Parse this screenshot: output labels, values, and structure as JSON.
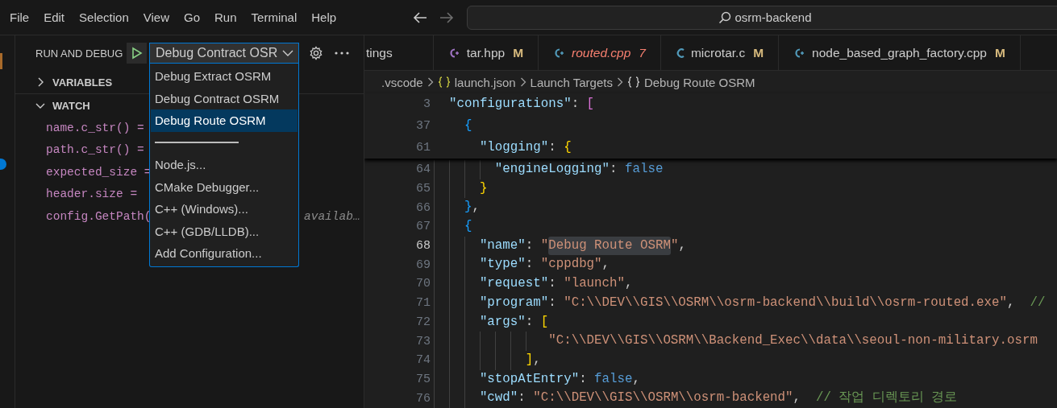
{
  "menu": [
    "File",
    "Edit",
    "Selection",
    "View",
    "Go",
    "Run",
    "Terminal",
    "Help"
  ],
  "search": {
    "value": "osrm-backend"
  },
  "sidebar": {
    "title": "RUN AND DEBUG",
    "config_select": {
      "value": "Debug Contract OSR",
      "expanded": true
    },
    "config_menu": [
      {
        "kind": "option",
        "label": "Debug Extract OSRM",
        "selected": false
      },
      {
        "kind": "option",
        "label": "Debug Contract OSRM",
        "selected": false
      },
      {
        "kind": "option",
        "label": "Debug Route OSRM",
        "selected": true
      },
      {
        "kind": "separator"
      },
      {
        "kind": "option",
        "label": "Node.js...",
        "selected": false
      },
      {
        "kind": "option",
        "label": "CMake Debugger...",
        "selected": false
      },
      {
        "kind": "option",
        "label": "C++ (Windows)...",
        "selected": false
      },
      {
        "kind": "option",
        "label": "C++ (GDB/LLDB)...",
        "selected": false
      },
      {
        "kind": "option",
        "label": "Add Configuration...",
        "selected": false
      }
    ],
    "sections": [
      {
        "title": "VARIABLES",
        "expanded": false
      },
      {
        "title": "WATCH",
        "expanded": true,
        "items": [
          {
            "expression": "name.c_str() ="
          },
          {
            "expression": "path.c_str() ="
          },
          {
            "expression": "expected_size ="
          },
          {
            "expression": "header.size ="
          },
          {
            "expression": "config.GetPath(",
            "value": "availab…"
          }
        ]
      }
    ]
  },
  "tabs": [
    {
      "label": "tings",
      "kind": "none",
      "error": false,
      "preview": false,
      "selected": false
    },
    {
      "label": "tar.hpp",
      "kind": "cpp-header",
      "status": "M",
      "error": false,
      "preview": false,
      "selected": false
    },
    {
      "label": "routed.cpp",
      "kind": "cpp",
      "status": "7",
      "error": true,
      "preview": true,
      "selected": false
    },
    {
      "label": "microtar.c",
      "kind": "c",
      "status": "M",
      "error": false,
      "preview": false,
      "selected": false
    },
    {
      "label": "node_based_graph_factory.cpp",
      "kind": "cpp",
      "status": "M",
      "error": false,
      "preview": false,
      "selected": false
    }
  ],
  "breadcrumbs": [
    {
      "label": ".vscode",
      "kind": "folder"
    },
    {
      "label": "launch.json",
      "kind": "json"
    },
    {
      "label": "Launch Targets",
      "kind": "folder"
    },
    {
      "label": "Debug Route OSRM",
      "kind": "object"
    }
  ],
  "sticky_lines": [
    {
      "number": "3",
      "current": false,
      "tokens": [
        {
          "text": "  \"configurations\"",
          "kind": "key"
        },
        {
          "text": ": ",
          "kind": "punct"
        },
        {
          "text": "[",
          "kind": "b2"
        }
      ]
    },
    {
      "number": "37",
      "current": false,
      "tokens": [
        {
          "text": "    {",
          "kind": "b3"
        }
      ]
    },
    {
      "number": "61",
      "current": false,
      "tokens": [
        {
          "text": "      \"logging\"",
          "kind": "key"
        },
        {
          "text": ": ",
          "kind": "punct"
        },
        {
          "text": "{",
          "kind": "b1"
        }
      ]
    }
  ],
  "lines": [
    {
      "number": "64",
      "current": false,
      "tokens": [
        {
          "text": "        \"engineLogging\"",
          "kind": "key"
        },
        {
          "text": ": ",
          "kind": "punct"
        },
        {
          "text": "false",
          "kind": "kw"
        }
      ]
    },
    {
      "number": "65",
      "current": false,
      "tokens": [
        {
          "text": "      }",
          "kind": "b1"
        }
      ]
    },
    {
      "number": "66",
      "current": false,
      "tokens": [
        {
          "text": "    }",
          "kind": "b3"
        },
        {
          "text": ",",
          "kind": "punct"
        }
      ]
    },
    {
      "number": "67",
      "current": false,
      "tokens": [
        {
          "text": "    {",
          "kind": "b3"
        }
      ]
    },
    {
      "number": "68",
      "current": true,
      "tokens": [
        {
          "text": "      \"name\"",
          "kind": "key"
        },
        {
          "text": ": ",
          "kind": "punct"
        },
        {
          "text": "\"",
          "kind": "str"
        },
        {
          "text": "Debug Route OSRM",
          "kind": "match"
        },
        {
          "text": "\"",
          "kind": "str"
        },
        {
          "text": ",",
          "kind": "punct"
        }
      ]
    },
    {
      "number": "69",
      "current": false,
      "tokens": [
        {
          "text": "      \"type\"",
          "kind": "key"
        },
        {
          "text": ": ",
          "kind": "punct"
        },
        {
          "text": "\"cppdbg\"",
          "kind": "str"
        },
        {
          "text": ",",
          "kind": "punct"
        }
      ]
    },
    {
      "number": "70",
      "current": false,
      "tokens": [
        {
          "text": "      \"request\"",
          "kind": "key"
        },
        {
          "text": ": ",
          "kind": "punct"
        },
        {
          "text": "\"launch\"",
          "kind": "str"
        },
        {
          "text": ",",
          "kind": "punct"
        }
      ]
    },
    {
      "number": "71",
      "current": false,
      "tokens": [
        {
          "text": "      \"program\"",
          "kind": "key"
        },
        {
          "text": ": ",
          "kind": "punct"
        },
        {
          "text": "\"C:\\\\DEV\\\\GIS\\\\OSRM\\\\osrm-backend\\\\build\\\\osrm-routed.exe\"",
          "kind": "str"
        },
        {
          "text": ",  ",
          "kind": "punct"
        },
        {
          "text": "//",
          "kind": "comment"
        }
      ]
    },
    {
      "number": "72",
      "current": false,
      "tokens": [
        {
          "text": "      \"args\"",
          "kind": "key"
        },
        {
          "text": ": ",
          "kind": "punct"
        },
        {
          "text": "[",
          "kind": "b1"
        }
      ]
    },
    {
      "number": "73",
      "current": false,
      "tokens": [
        {
          "text": "               \"C:\\\\DEV\\\\GIS\\\\OSRM\\\\Backend_Exec\\\\data\\\\seoul-non-military.osrm",
          "kind": "str"
        }
      ]
    },
    {
      "number": "74",
      "current": false,
      "tokens": [
        {
          "text": "            ]",
          "kind": "b1"
        },
        {
          "text": ",",
          "kind": "punct"
        }
      ]
    },
    {
      "number": "75",
      "current": false,
      "tokens": [
        {
          "text": "      \"stopAtEntry\"",
          "kind": "key"
        },
        {
          "text": ": ",
          "kind": "punct"
        },
        {
          "text": "false",
          "kind": "kw"
        },
        {
          "text": ",",
          "kind": "punct"
        }
      ]
    },
    {
      "number": "76",
      "current": false,
      "tokens": [
        {
          "text": "      \"cwd\"",
          "kind": "key"
        },
        {
          "text": ": ",
          "kind": "punct"
        },
        {
          "text": "\"C:\\\\DEV\\\\GIS\\\\OSRM\\\\osrm-backend\"",
          "kind": "str"
        },
        {
          "text": ",  ",
          "kind": "punct"
        },
        {
          "text": "// 작업 디렉토리 경로",
          "kind": "comment"
        }
      ]
    }
  ]
}
